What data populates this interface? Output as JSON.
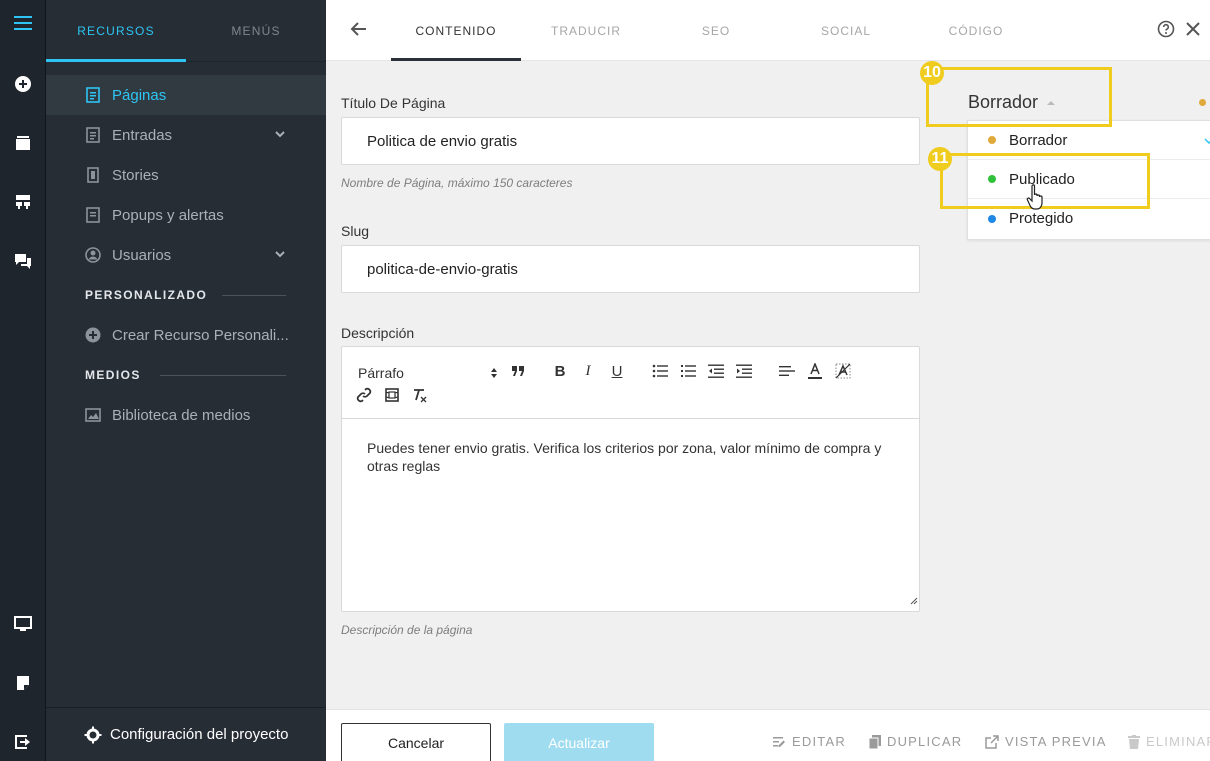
{
  "sidebar": {
    "tabs": [
      {
        "label": "RECURSOS"
      },
      {
        "label": "MENÚS"
      }
    ],
    "items": [
      {
        "label": "Páginas"
      },
      {
        "label": "Entradas"
      },
      {
        "label": "Stories"
      },
      {
        "label": "Popups y alertas"
      },
      {
        "label": "Usuarios"
      }
    ],
    "section_custom": "PERSONALIZADO",
    "custom_item": "Crear Recurso Personali...",
    "section_media": "MEDIOS",
    "media_item": "Biblioteca de medios",
    "footer": "Configuración del proyecto"
  },
  "topbar": {
    "tabs": [
      {
        "label": "CONTENIDO"
      },
      {
        "label": "TRADUCIR"
      },
      {
        "label": "SEO"
      },
      {
        "label": "SOCIAL"
      },
      {
        "label": "CÓDIGO"
      }
    ]
  },
  "form": {
    "title_label": "Título De Página",
    "title_value": "Politica de envio gratis",
    "title_hint": "Nombre de Página, máximo 150 caracteres",
    "slug_label": "Slug",
    "slug_value": "politica-de-envio-gratis",
    "desc_label": "Descripción",
    "paragraph_select": "Párrafo",
    "desc_body": "Puedes tener envio gratis. Verifica los criterios por zona, valor mínimo de compra y otras reglas",
    "desc_hint": "Descripción de la página"
  },
  "status": {
    "current": "Borrador",
    "options": [
      {
        "label": "Borrador",
        "color": "#e0a93a"
      },
      {
        "label": "Publicado",
        "color": "#2fc13a"
      },
      {
        "label": "Protegido",
        "color": "#1e88e5"
      }
    ],
    "step_badges": [
      "10",
      "11"
    ]
  },
  "bottombar": {
    "cancel": "Cancelar",
    "update": "Actualizar",
    "edit": "EDITAR",
    "duplicate": "DUPLICAR",
    "preview": "VISTA PREVIA",
    "delete": "ELIMINAR"
  },
  "colors": {
    "accent": "#2ec5f4",
    "highlight": "#efcc1d",
    "rail": "#1f252c",
    "sidebar": "#262d35"
  }
}
